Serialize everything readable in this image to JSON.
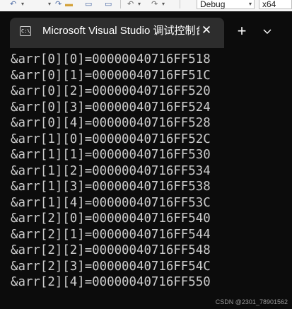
{
  "ide_toolbar": {
    "configuration": "Debug",
    "platform": "x64"
  },
  "terminal_window": {
    "tab_title": "Microsoft Visual Studio 调试控制台",
    "app_icon_text": "C:\\",
    "close_symbol": "✕",
    "new_tab_symbol": "+",
    "dropdown_symbol": "⌄"
  },
  "output_lines": [
    "&arr[0][0]=00000040716FF518",
    "&arr[0][1]=00000040716FF51C",
    "&arr[0][2]=00000040716FF520",
    "&arr[0][3]=00000040716FF524",
    "&arr[0][4]=00000040716FF528",
    "&arr[1][0]=00000040716FF52C",
    "&arr[1][1]=00000040716FF530",
    "&arr[1][2]=00000040716FF534",
    "&arr[1][3]=00000040716FF538",
    "&arr[1][4]=00000040716FF53C",
    "&arr[2][0]=00000040716FF540",
    "&arr[2][1]=00000040716FF544",
    "&arr[2][2]=00000040716FF548",
    "&arr[2][3]=00000040716FF54C",
    "&arr[2][4]=00000040716FF550"
  ],
  "watermark": "CSDN @2301_78901562",
  "colors": {
    "terminal_background": "#0c0c0c",
    "tab_background": "#2d2d2d",
    "output_text": "#cccccc",
    "title_text": "#ffffff"
  },
  "icons": {
    "tab_app": "console-icon",
    "tab_close": "close-icon",
    "new_tab": "plus-icon",
    "tab_dropdown": "chevron-down-icon"
  }
}
